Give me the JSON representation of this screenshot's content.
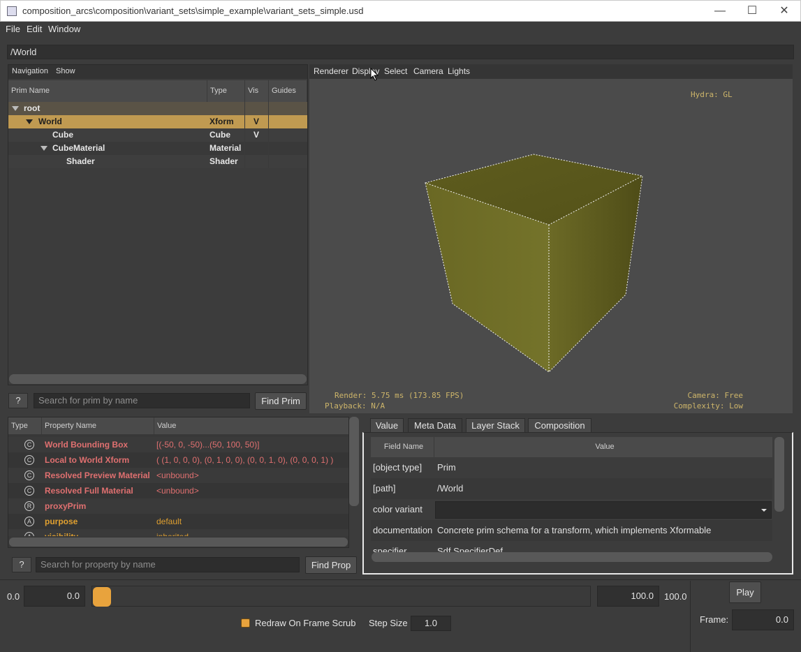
{
  "window": {
    "title": "composition_arcs\\composition\\variant_sets\\simple_example\\variant_sets_simple.usd",
    "minimize_glyph": "—",
    "maximize_glyph": "☐",
    "close_glyph": "✕"
  },
  "menu": {
    "file": "File",
    "edit": "Edit",
    "window": "Window"
  },
  "path": {
    "value": "/World"
  },
  "prim_browser": {
    "tabs": {
      "navigation": "Navigation",
      "show": "Show"
    },
    "columns": {
      "name": "Prim Name",
      "type": "Type",
      "vis": "Vis",
      "guides": "Guides"
    },
    "rows": [
      {
        "name": "root",
        "type": "",
        "vis": ""
      },
      {
        "name": "World",
        "type": "Xform",
        "vis": "V"
      },
      {
        "name": "Cube",
        "type": "Cube",
        "vis": "V"
      },
      {
        "name": "CubeMaterial",
        "type": "Material",
        "vis": ""
      },
      {
        "name": "Shader",
        "type": "Shader",
        "vis": ""
      }
    ],
    "help_label": "?",
    "search_placeholder": "Search for prim by name",
    "find_label": "Find Prim"
  },
  "viewport": {
    "menu": {
      "renderer": "Renderer",
      "display": "Display",
      "select": "Select",
      "camera": "Camera",
      "lights": "Lights"
    },
    "hud": {
      "hydra": "Hydra: GL",
      "render": "Render: 5.75 ms (173.85 FPS)",
      "playback": "Playback: N/A",
      "camera": "Camera: Free",
      "complexity": "Complexity: Low"
    },
    "cube_color": "#6b6a22"
  },
  "properties": {
    "columns": {
      "type": "Type",
      "name": "Property Name",
      "value": "Value"
    },
    "rows": [
      {
        "icon": "C",
        "name": "World Bounding Box",
        "value": "[(-50, 0, -50)...(50, 100, 50)]"
      },
      {
        "icon": "C",
        "name": "Local to World Xform",
        "value": "( (1, 0, 0, 0), (0, 1, 0, 0), (0, 0, 1, 0), (0, 0, 0, 1) )"
      },
      {
        "icon": "C",
        "name": "Resolved Preview Material",
        "value": "<unbound>"
      },
      {
        "icon": "C",
        "name": "Resolved Full Material",
        "value": "<unbound>"
      },
      {
        "icon": "R",
        "name": "proxyPrim",
        "value": ""
      },
      {
        "icon": "A",
        "name": "purpose",
        "value": "default"
      },
      {
        "icon": "A",
        "name": "visibility",
        "value": "inherited"
      }
    ],
    "help_label": "?",
    "search_placeholder": "Search for property by name",
    "find_label": "Find Prop",
    "computed_color": "#e07070",
    "attribute_color": "#e0a030"
  },
  "metadata": {
    "tabs": {
      "value": "Value",
      "meta": "Meta Data",
      "layer": "Layer Stack",
      "composition": "Composition"
    },
    "columns": {
      "field": "Field Name",
      "value": "Value"
    },
    "rows": [
      {
        "field": "[object type]",
        "value": "Prim"
      },
      {
        "field": "[path]",
        "value": "/World"
      },
      {
        "field": "color variant",
        "value": ""
      },
      {
        "field": "documentation",
        "value": "Concrete prim schema for a transform, which implements Xformable"
      },
      {
        "field": "specifier",
        "value": "Sdf.SpecifierDef"
      }
    ]
  },
  "timeline": {
    "start_label": "0.0",
    "start_value": "0.0",
    "end_value": "100.0",
    "end_label": "100.0",
    "play_label": "Play",
    "frame_label": "Frame:",
    "frame_value": "0.0",
    "redraw_label": "Redraw On Frame Scrub",
    "redraw_checked": true,
    "step_label": "Step Size",
    "step_value": "1.0",
    "accent": "#e8a33d"
  }
}
